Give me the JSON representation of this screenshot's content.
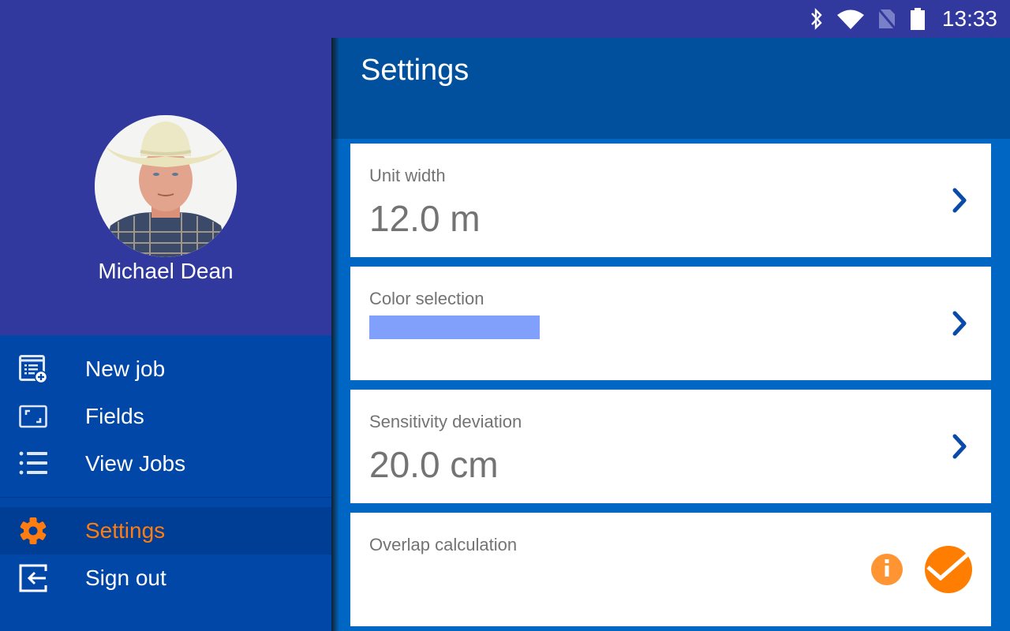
{
  "status_bar": {
    "icons": [
      "bluetooth-icon",
      "wifi-icon",
      "no-sim-icon",
      "battery-icon"
    ],
    "time": "13:33"
  },
  "drawer": {
    "user": {
      "name": "Michael Dean",
      "avatar": "user-photo"
    },
    "items": [
      {
        "label": "New job",
        "icon": "new-job-icon",
        "active": false
      },
      {
        "label": "Fields",
        "icon": "fields-icon",
        "active": false
      },
      {
        "label": "View Jobs",
        "icon": "list-icon",
        "active": false
      },
      {
        "label": "Settings",
        "icon": "gear-icon",
        "active": true
      },
      {
        "label": "Sign out",
        "icon": "sign-out-icon",
        "active": false
      }
    ]
  },
  "main": {
    "title": "Settings",
    "settings": [
      {
        "label": "Unit width",
        "value": "12.0 m"
      },
      {
        "label": "Color selection",
        "color": "#80a0fc"
      },
      {
        "label": "Sensitivity deviation",
        "value": "20.0 cm"
      },
      {
        "label": "Overlap calculation",
        "info": "i",
        "checked": true
      }
    ]
  },
  "colors": {
    "status_bar": "#31399e",
    "drawer": "#0047a8",
    "app_bar": "#00509e",
    "background": "#0066c4",
    "accent": "#ff7d10",
    "chevron": "#0a4aa8"
  }
}
